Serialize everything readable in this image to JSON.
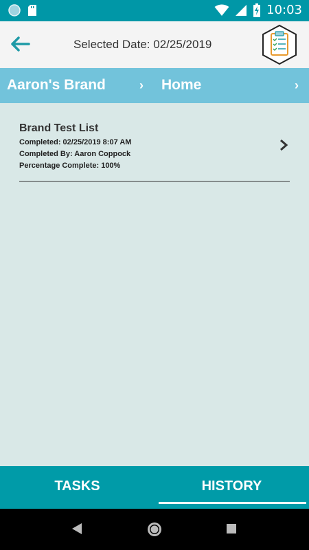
{
  "status_bar": {
    "time": "10:03",
    "icons": [
      "circle-notification-icon",
      "sd-card-icon",
      "wifi-icon",
      "signal-icon",
      "battery-charging-icon"
    ]
  },
  "header": {
    "selected_date_label": "Selected Date: 02/25/2019",
    "back_icon": "arrow-left-icon",
    "checklist_icon": "clipboard-checklist-icon"
  },
  "breadcrumbs": [
    {
      "label": "Aaron's Brand"
    },
    {
      "label": "Home"
    }
  ],
  "history_items": [
    {
      "title": "Brand Test List",
      "completed": "Completed: 02/25/2019 8:07 AM",
      "completed_by": "Completed By: Aaron Coppock",
      "percentage": "Percentage Complete: 100%"
    }
  ],
  "tabs": [
    {
      "label": "TASKS",
      "active": false
    },
    {
      "label": "HISTORY",
      "active": true
    }
  ],
  "colors": {
    "status_bar": "#0097A7",
    "breadcrumb_bar": "#72C3DB",
    "content_bg": "#D9E8E7",
    "tab_bar": "#009BA8",
    "accent_arrow": "#1E9AA6"
  },
  "nav": [
    "back-triangle-icon",
    "home-circle-icon",
    "recents-square-icon"
  ]
}
